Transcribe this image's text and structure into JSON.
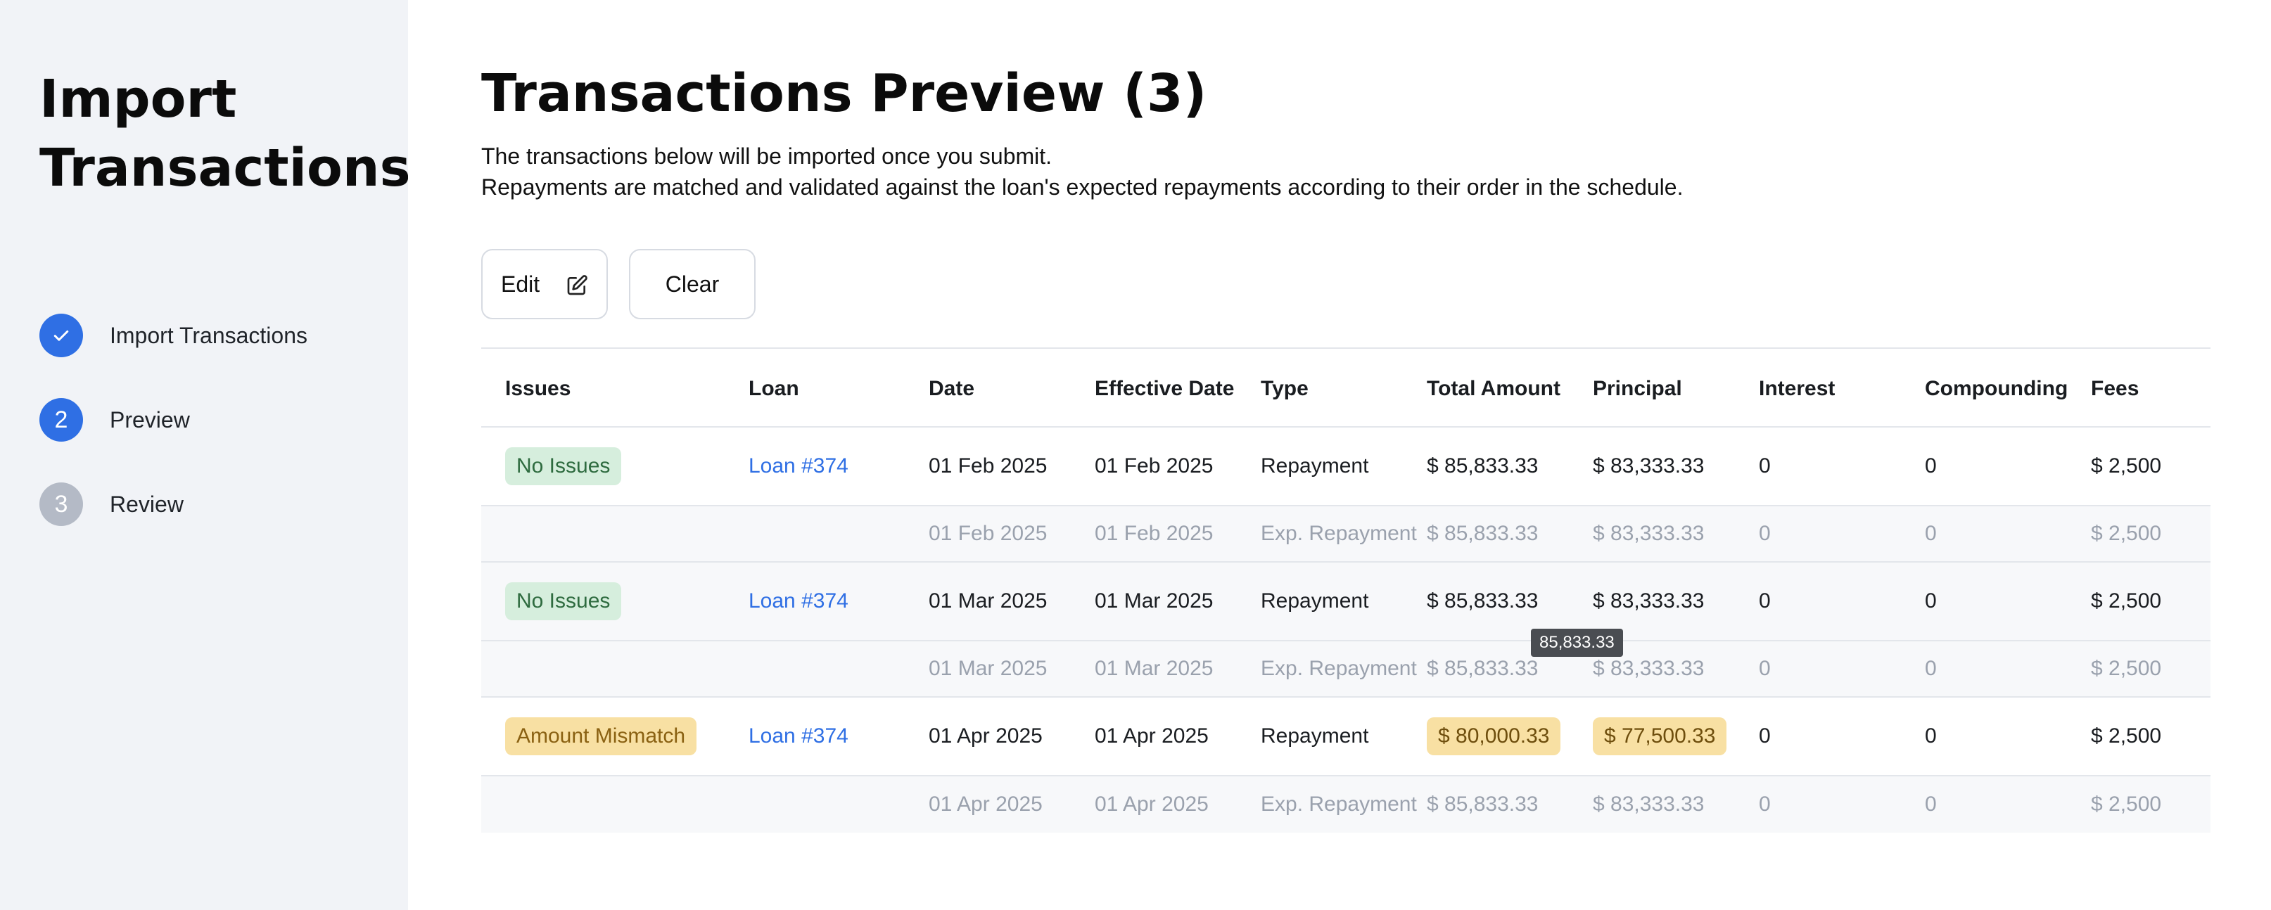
{
  "sidebar": {
    "title": "Import Transactions",
    "steps": [
      {
        "number": "✓",
        "label": "Import Transactions",
        "state": "done"
      },
      {
        "number": "2",
        "label": "Preview",
        "state": "current"
      },
      {
        "number": "3",
        "label": "Review",
        "state": "pending"
      }
    ]
  },
  "main": {
    "title": "Transactions Preview (3)",
    "description_line1": "The transactions below will be imported once you submit.",
    "description_line2": "Repayments are matched and validated against the loan's expected repayments according to their order in the schedule.",
    "edit_label": "Edit",
    "clear_label": "Clear"
  },
  "table": {
    "headers": [
      "Issues",
      "Loan",
      "Date",
      "Effective Date",
      "Type",
      "Total Amount",
      "Principal",
      "Interest",
      "Compounding",
      "Fees"
    ],
    "rows": [
      {
        "issue": "No Issues",
        "issue_kind": "ok",
        "loan": "Loan #374",
        "date": "01 Feb 2025",
        "effective_date": "01 Feb 2025",
        "type": "Repayment",
        "total": "$ 85,833.33",
        "principal": "$ 83,333.33",
        "interest": "0",
        "compounding": "0",
        "fees": "$ 2,500",
        "expected": {
          "date": "01 Feb 2025",
          "effective_date": "01 Feb 2025",
          "type": "Exp. Repayment",
          "total": "$ 85,833.33",
          "principal": "$ 83,333.33",
          "interest": "0",
          "compounding": "0",
          "fees": "$ 2,500"
        }
      },
      {
        "issue": "No Issues",
        "issue_kind": "ok",
        "loan": "Loan #374",
        "date": "01 Mar 2025",
        "effective_date": "01 Mar 2025",
        "type": "Repayment",
        "total": "$ 85,833.33",
        "principal": "$ 83,333.33",
        "interest": "0",
        "compounding": "0",
        "fees": "$ 2,500",
        "expected": {
          "date": "01 Mar 2025",
          "effective_date": "01 Mar 2025",
          "type": "Exp. Repayment",
          "total": "$ 85,833.33",
          "principal": "$ 83,333.33",
          "interest": "0",
          "compounding": "0",
          "fees": "$ 2,500"
        }
      },
      {
        "issue": "Amount Mismatch",
        "issue_kind": "warn",
        "loan": "Loan #374",
        "date": "01 Apr 2025",
        "effective_date": "01 Apr 2025",
        "type": "Repayment",
        "total": "$ 80,000.33",
        "principal": "$ 77,500.33",
        "interest": "0",
        "compounding": "0",
        "fees": "$ 2,500",
        "expected": {
          "date": "01 Apr 2025",
          "effective_date": "01 Apr 2025",
          "type": "Exp. Repayment",
          "total": "$ 85,833.33",
          "principal": "$ 83,333.33",
          "interest": "0",
          "compounding": "0",
          "fees": "$ 2,500"
        }
      }
    ]
  },
  "tooltip": {
    "text": "85,833.33"
  },
  "colors": {
    "accent": "#2f6fe4",
    "ok_bg": "#d6eedd",
    "warn_bg": "#f8e0a3"
  }
}
